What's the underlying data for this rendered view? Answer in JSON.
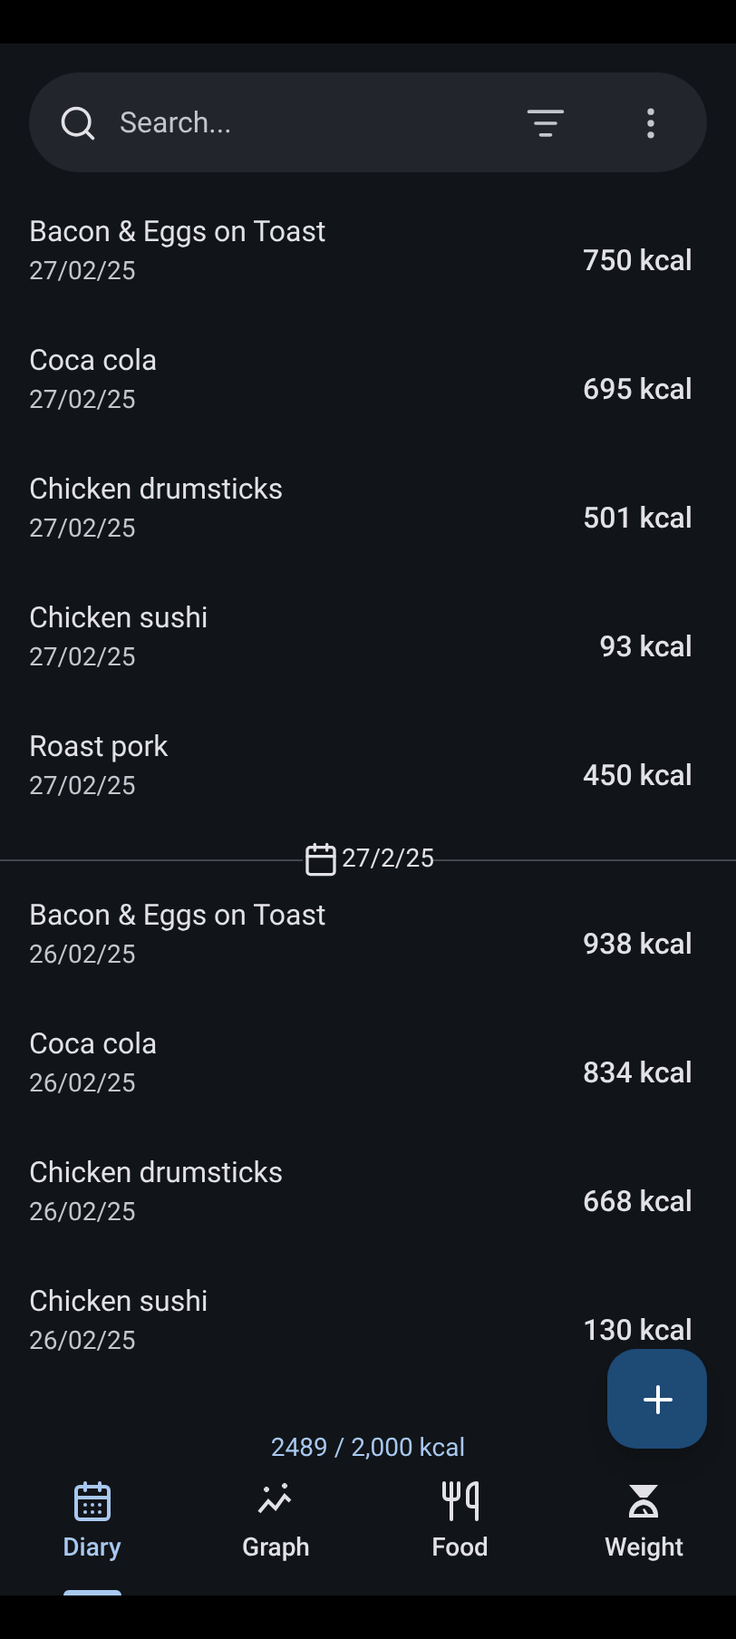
{
  "search": {
    "placeholder": "Search..."
  },
  "groups": [
    {
      "entries": [
        {
          "name": "Bacon & Eggs on Toast",
          "date": "27/02/25",
          "kcal": "750 kcal"
        },
        {
          "name": "Coca cola",
          "date": "27/02/25",
          "kcal": "695 kcal"
        },
        {
          "name": "Chicken drumsticks",
          "date": "27/02/25",
          "kcal": "501 kcal"
        },
        {
          "name": "Chicken sushi",
          "date": "27/02/25",
          "kcal": "93 kcal"
        },
        {
          "name": "Roast pork",
          "date": "27/02/25",
          "kcal": "450 kcal"
        }
      ]
    },
    {
      "divider": "27/2/25",
      "entries": [
        {
          "name": "Bacon & Eggs on Toast",
          "date": "26/02/25",
          "kcal": "938 kcal"
        },
        {
          "name": "Coca cola",
          "date": "26/02/25",
          "kcal": "834 kcal"
        },
        {
          "name": "Chicken drumsticks",
          "date": "26/02/25",
          "kcal": "668 kcal"
        },
        {
          "name": "Chicken sushi",
          "date": "26/02/25",
          "kcal": "130 kcal"
        }
      ]
    }
  ],
  "summary": "2489 / 2,000 kcal",
  "nav": [
    {
      "label": "Diary",
      "kind": "diary",
      "selected": true
    },
    {
      "label": "Graph",
      "kind": "graph",
      "selected": false
    },
    {
      "label": "Food",
      "kind": "food",
      "selected": false
    },
    {
      "label": "Weight",
      "kind": "weight",
      "selected": false
    }
  ]
}
